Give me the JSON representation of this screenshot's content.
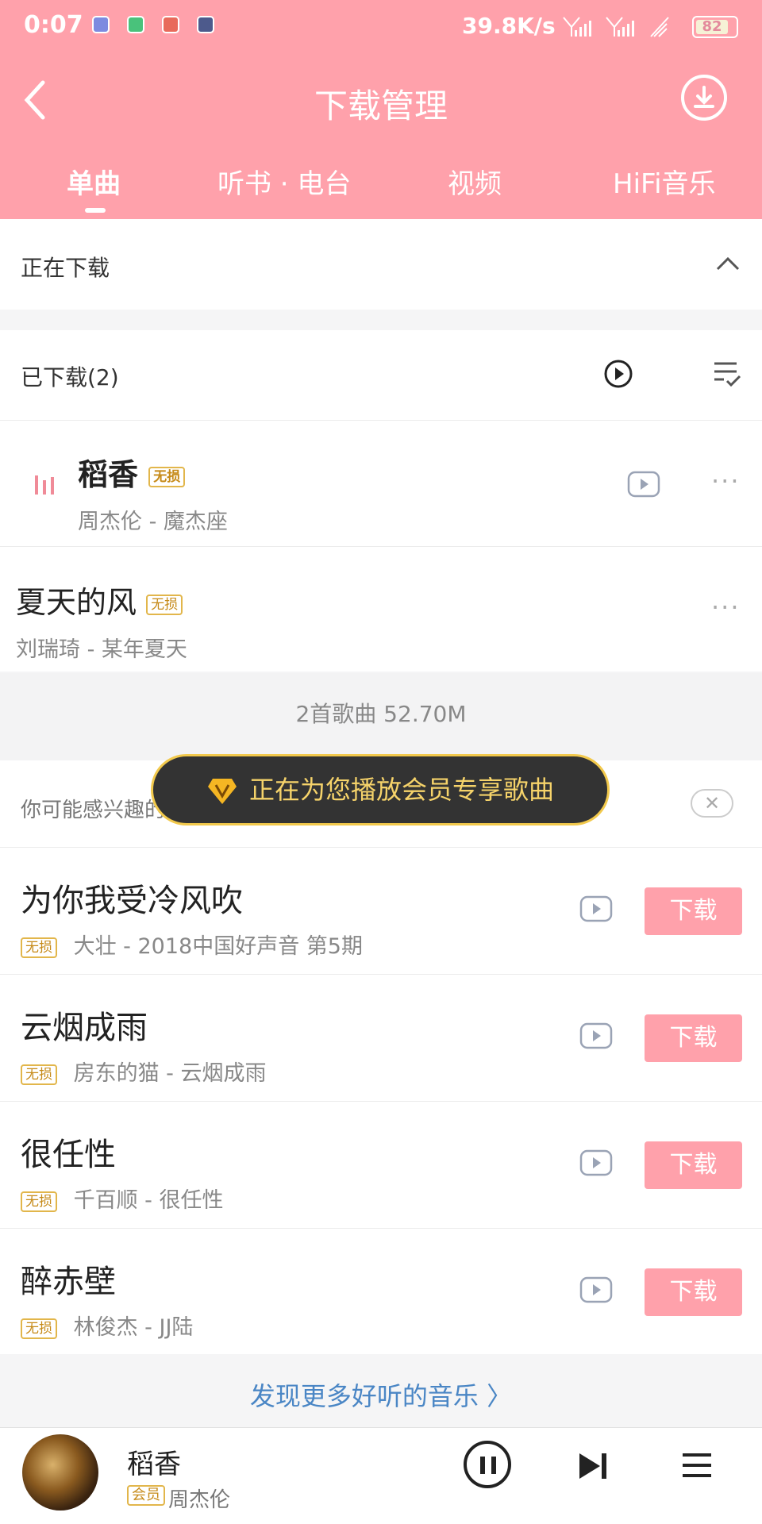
{
  "status_bar": {
    "time": "0:07",
    "speed": "39.8K/s",
    "battery": "82"
  },
  "header": {
    "title": "下载管理",
    "tabs": [
      {
        "label": "单曲",
        "active": true
      },
      {
        "label": "听书 · 电台",
        "active": false
      },
      {
        "label": "视频",
        "active": false
      },
      {
        "label": "HiFi音乐",
        "active": false
      }
    ]
  },
  "downloading": {
    "label": "正在下载"
  },
  "downloaded": {
    "label": "已下载(2)",
    "songs": [
      {
        "title": "稻香",
        "badge": "无损",
        "subtitle": "周杰伦 - 魔杰座",
        "playing": true
      },
      {
        "title": "夏天的风",
        "badge": "无损",
        "subtitle": "刘瑞琦 - 某年夏天",
        "playing": false
      }
    ],
    "summary": "2首歌曲 52.70M"
  },
  "recommendations": {
    "label": "你可能感兴趣的音乐",
    "items": [
      {
        "title": "为你我受冷风吹",
        "badge": "无损",
        "subtitle": "大壮 - 2018中国好声音 第5期",
        "action": "下载"
      },
      {
        "title": "云烟成雨",
        "badge": "无损",
        "subtitle": "房东的猫 - 云烟成雨",
        "action": "下载"
      },
      {
        "title": "很任性",
        "badge": "无损",
        "subtitle": "千百顺 - 很任性",
        "action": "下载"
      },
      {
        "title": "醉赤壁",
        "badge": "无损",
        "subtitle": "林俊杰 - JJ陆",
        "action": "下载"
      }
    ]
  },
  "toast": {
    "text": "正在为您播放会员专享歌曲"
  },
  "discover": {
    "text": "发现更多好听的音乐 〉"
  },
  "player": {
    "title": "稻香",
    "badge": "会员",
    "artist": "周杰伦"
  },
  "colors": {
    "brand": "#ffa1ab",
    "badge": "#c68a18",
    "link": "#4a86c5"
  }
}
